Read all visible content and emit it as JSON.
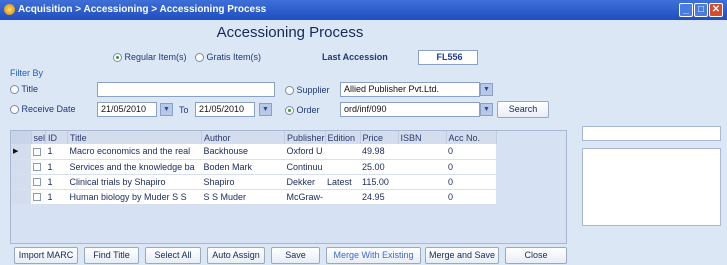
{
  "window": {
    "title": "Acquisition > Accessioning > Accessioning Process"
  },
  "heading": "Accessioning Process",
  "item_type": {
    "regular_label": "Regular Item(s)",
    "gratis_label": "Gratis Item(s)",
    "selected": "regular"
  },
  "last_accession": {
    "label": "Last Accession",
    "value": "FL556"
  },
  "filter": {
    "label": "Filter By",
    "title_label": "Title",
    "title_value": "",
    "receive_date_label": "Receive Date",
    "from_date": "21/05/2010",
    "to_label": "To",
    "to_date": "21/05/2010",
    "supplier_label": "Supplier",
    "supplier_value": "Allied Publisher Pvt.Ltd.",
    "order_label": "Order",
    "order_value": "ord/inf/090",
    "search_label": "Search",
    "selected": "order"
  },
  "grid": {
    "columns": [
      "sel",
      "ID",
      "Title",
      "Author",
      "Publisher",
      "Edition",
      "Price",
      "ISBN",
      "Acc No."
    ],
    "rows": [
      {
        "id": "1",
        "title": "Macro economics and the real",
        "author": "Backhouse",
        "publisher": "Oxford U",
        "edition": "",
        "price": "49.98",
        "isbn": "",
        "acc_no": "0"
      },
      {
        "id": "1",
        "title": "Services and the knowledge ba",
        "author": "Boden Mark",
        "publisher": "Continuu",
        "edition": "",
        "price": "25.00",
        "isbn": "",
        "acc_no": "0"
      },
      {
        "id": "1",
        "title": "Clinical trials by Shapiro",
        "author": "Shapiro",
        "publisher": "Dekker",
        "edition": "Latest",
        "price": "115.00",
        "isbn": "",
        "acc_no": "0"
      },
      {
        "id": "1",
        "title": "Human biology by Muder S S",
        "author": "S S Muder",
        "publisher": "McGraw-",
        "edition": "",
        "price": "24.95",
        "isbn": "",
        "acc_no": "0"
      }
    ]
  },
  "buttons": {
    "import_marc": "Import MARC",
    "find_title": "Find Title",
    "select_all": "Select All",
    "auto_assign": "Auto Assign",
    "save": "Save",
    "merge_existing": "Merge With Existing",
    "merge_save": "Merge and Save",
    "close": "Close"
  },
  "colors": {
    "titlebar": "#1f4fc0",
    "background": "#dce7f6",
    "merge_existing_text": "#3a6ad0"
  }
}
